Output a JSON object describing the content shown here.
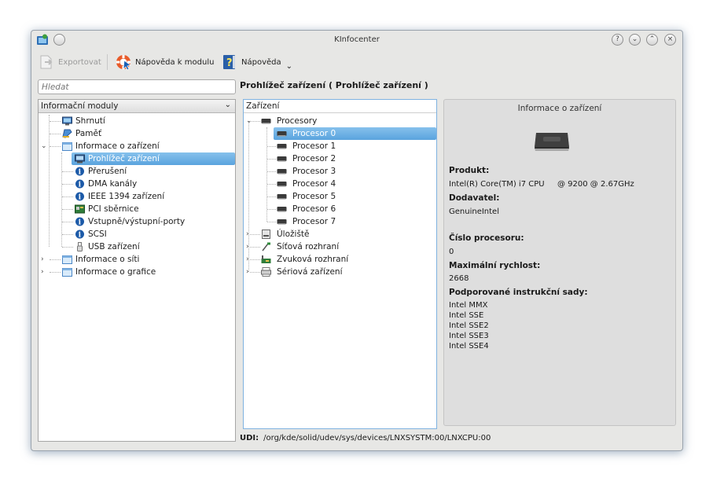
{
  "window": {
    "title": "KInfocenter"
  },
  "toolbar": {
    "export_label": "Exportovat",
    "module_help_label": "Nápověda k modulu",
    "help_label": "Nápověda"
  },
  "search": {
    "placeholder": "Hledat"
  },
  "heading": "Prohlížeč zařízení  ( Prohlížeč zařízení )",
  "modules": {
    "header": "Informační moduly",
    "items": [
      {
        "label": "Shrnutí",
        "icon": "monitor-icon"
      },
      {
        "label": "Paměť",
        "icon": "memory-icon"
      },
      {
        "label": "Informace o zařízení",
        "icon": "folder-icon"
      },
      {
        "label": "Prohlížeč zařízení",
        "icon": "device-viewer-icon"
      },
      {
        "label": "Přerušení",
        "icon": "info-icon"
      },
      {
        "label": "DMA kanály",
        "icon": "info-icon"
      },
      {
        "label": "IEEE 1394 zařízení",
        "icon": "info-icon"
      },
      {
        "label": "PCI sběrnice",
        "icon": "pci-icon"
      },
      {
        "label": "Vstupně/výstupní-porty",
        "icon": "info-icon"
      },
      {
        "label": "SCSI",
        "icon": "info-icon"
      },
      {
        "label": "USB zařízení",
        "icon": "usb-icon"
      },
      {
        "label": "Informace o síti",
        "icon": "folder-icon"
      },
      {
        "label": "Informace o grafice",
        "icon": "folder-icon"
      }
    ]
  },
  "devices": {
    "header": "Zařízení",
    "items": [
      {
        "label": "Procesory",
        "icon": "cpu-icon"
      },
      {
        "label": "Procesor 0",
        "icon": "cpu-icon"
      },
      {
        "label": "Procesor 1",
        "icon": "cpu-icon"
      },
      {
        "label": "Procesor 2",
        "icon": "cpu-icon"
      },
      {
        "label": "Procesor 3",
        "icon": "cpu-icon"
      },
      {
        "label": "Procesor 4",
        "icon": "cpu-icon"
      },
      {
        "label": "Procesor 5",
        "icon": "cpu-icon"
      },
      {
        "label": "Procesor 6",
        "icon": "cpu-icon"
      },
      {
        "label": "Procesor 7",
        "icon": "cpu-icon"
      },
      {
        "label": "Úložiště",
        "icon": "storage-icon"
      },
      {
        "label": "Síťová rozhraní",
        "icon": "network-icon"
      },
      {
        "label": "Zvuková rozhraní",
        "icon": "sound-card-icon"
      },
      {
        "label": "Sériová zařízení",
        "icon": "serial-icon"
      }
    ]
  },
  "info": {
    "title": "Informace o zařízení",
    "product_label": "Produkt:",
    "product_value": "Intel(R) Core(TM) i7 CPU",
    "product_value2": "@ 9200 @ 2.67GHz",
    "vendor_label": "Dodavatel:",
    "vendor_value": "GenuineIntel",
    "cpu_number_label": "Číslo procesoru:",
    "cpu_number_value": "0",
    "max_speed_label": "Maximální rychlost:",
    "max_speed_value": "2668",
    "instr_label": "Podporované instrukční sady:",
    "instr": [
      "Intel MMX",
      "Intel SSE",
      "Intel SSE2",
      "Intel SSE3",
      "Intel SSE4"
    ]
  },
  "udi": {
    "label": "UDI:",
    "value": "/org/kde/solid/udev/sys/devices/LNXSYSTM:00/LNXCPU:00"
  }
}
